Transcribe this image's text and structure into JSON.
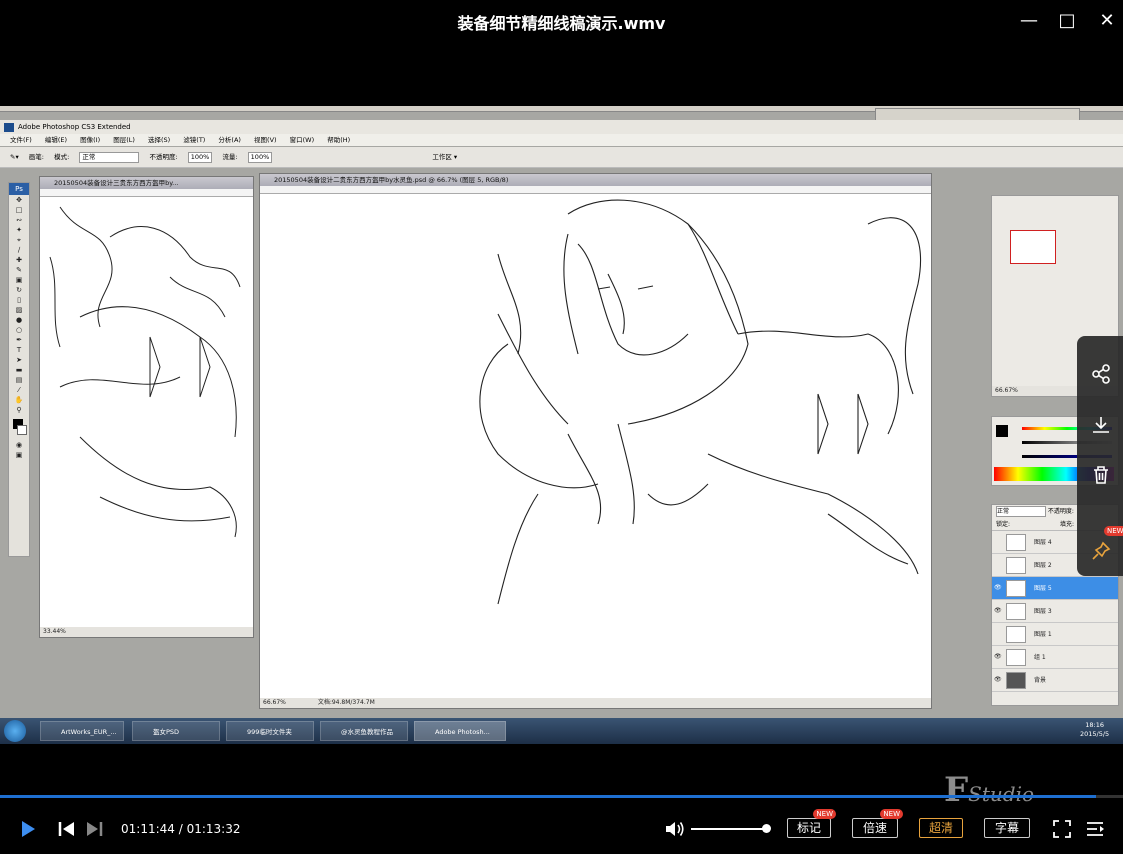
{
  "player": {
    "title": "装备细节精细线稿演示.wmv",
    "current_time": "01:11:44",
    "total_time": "01:13:32",
    "time_sep": " / ",
    "progress_fraction": 0.976,
    "volume_fraction": 1.0,
    "buttons": {
      "mark": "标记",
      "speed": "倍速",
      "quality": "超清",
      "subtitle": "字幕"
    },
    "new_tag": "NEW",
    "accent_color": "#1e6fd0",
    "quality_color": "#e8a33d"
  },
  "photoshop": {
    "app_title": "Adobe Photoshop CS3 Extended",
    "menu": [
      "文件(F)",
      "编辑(E)",
      "图像(I)",
      "图层(L)",
      "选择(S)",
      "滤镜(T)",
      "分析(A)",
      "视图(V)",
      "窗口(W)",
      "帮助(H)"
    ],
    "options": {
      "brush_label": "画笔:",
      "mode_label": "模式:",
      "mode_value": "正常",
      "opacity_label": "不透明度:",
      "opacity_value": "100%",
      "flow_label": "流量:",
      "flow_value": "100%",
      "workspace": "工作区 ▾"
    },
    "doc_small": {
      "title": "20150504装备设计三贵东方西方盔甲by...",
      "zoom": "33.44%"
    },
    "doc_main": {
      "title": "20150504装备设计二贵东方西方盔甲by水灵鱼.psd @ 66.7% (图层 5, RGB/8)",
      "zoom": "66.67%",
      "doc_size": "文档:94.8M/374.7M"
    },
    "layers_panel": {
      "mode": "正常",
      "opacity_label": "不透明度:",
      "lock_label": "锁定:",
      "fill_label": "填充:",
      "layers": [
        {
          "name": "图层 4",
          "visible": false,
          "selected": false
        },
        {
          "name": "图层 2",
          "visible": false,
          "selected": false
        },
        {
          "name": "图层 5",
          "visible": true,
          "selected": true
        },
        {
          "name": "图层 3",
          "visible": true,
          "selected": false
        },
        {
          "name": "图层 1",
          "visible": false,
          "selected": false
        },
        {
          "name": "组 1",
          "visible": true,
          "selected": false
        },
        {
          "name": "背景",
          "visible": true,
          "selected": false
        }
      ]
    },
    "navigator_zoom": "66.67%"
  },
  "taskbar": {
    "items": [
      "ArtWorks_EUR_...",
      "盔女PSD",
      "999临时文件夹",
      "@水灵鱼教程作品",
      "Adobe Photosh..."
    ],
    "clock_time": "18:16",
    "clock_date": "2015/5/5"
  },
  "watermark": "Studio",
  "icons": [
    "share-icon",
    "download-icon",
    "trash-icon",
    "pin-icon",
    "play-icon",
    "prev-icon",
    "next-icon",
    "volume-icon",
    "fullscreen-icon",
    "playlist-icon",
    "close-icon",
    "maximize-icon",
    "minimize-icon"
  ]
}
